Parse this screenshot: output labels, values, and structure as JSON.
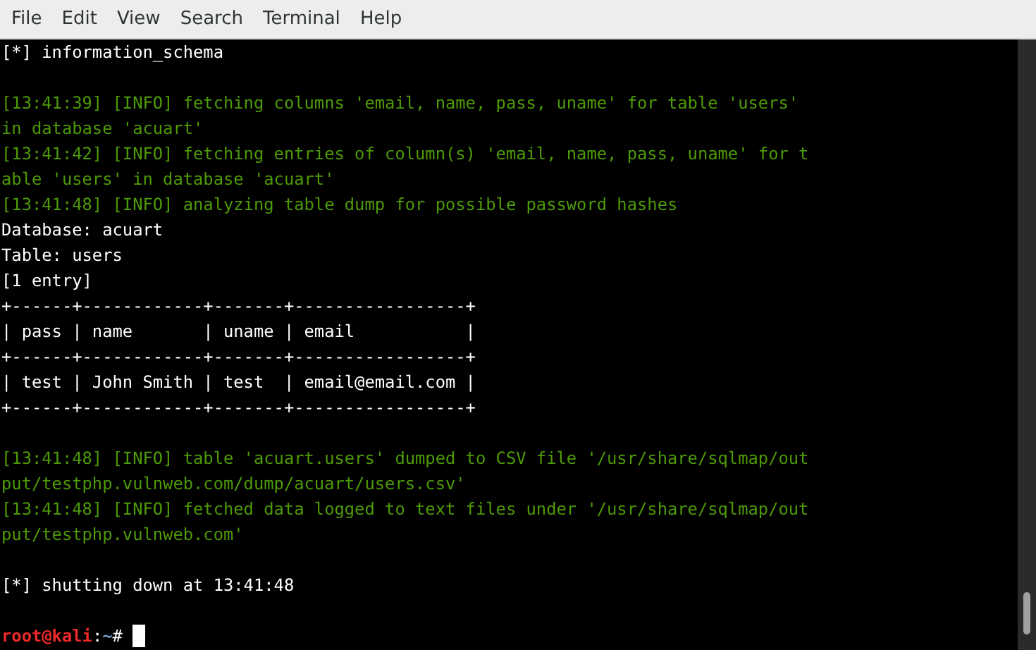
{
  "menu": [
    "File",
    "Edit",
    "View",
    "Search",
    "Terminal",
    "Help"
  ],
  "lines": [
    {
      "kind": "plain",
      "text": "[*] information_schema"
    },
    {
      "kind": "blank"
    },
    {
      "kind": "info",
      "text": "[13:41:39] [INFO] fetching columns 'email, name, pass, uname' for table 'users'"
    },
    {
      "kind": "info",
      "text": "in database 'acuart'"
    },
    {
      "kind": "info",
      "text": "[13:41:42] [INFO] fetching entries of column(s) 'email, name, pass, uname' for t"
    },
    {
      "kind": "info",
      "text": "able 'users' in database 'acuart'"
    },
    {
      "kind": "info",
      "text": "[13:41:48] [INFO] analyzing table dump for possible password hashes"
    },
    {
      "kind": "plain",
      "text": "Database: acuart"
    },
    {
      "kind": "plain",
      "text": "Table: users"
    },
    {
      "kind": "plain",
      "text": "[1 entry]"
    },
    {
      "kind": "plain",
      "text": "+------+------------+-------+-----------------+"
    },
    {
      "kind": "plain",
      "text": "| pass | name       | uname | email           |"
    },
    {
      "kind": "plain",
      "text": "+------+------------+-------+-----------------+"
    },
    {
      "kind": "plain",
      "text": "| test | John Smith | test  | email@email.com |"
    },
    {
      "kind": "plain",
      "text": "+------+------------+-------+-----------------+"
    },
    {
      "kind": "blank"
    },
    {
      "kind": "info",
      "text": "[13:41:48] [INFO] table 'acuart.users' dumped to CSV file '/usr/share/sqlmap/out"
    },
    {
      "kind": "info",
      "text": "put/testphp.vulnweb.com/dump/acuart/users.csv'"
    },
    {
      "kind": "info",
      "text": "[13:41:48] [INFO] fetched data logged to text files under '/usr/share/sqlmap/out"
    },
    {
      "kind": "info",
      "text": "put/testphp.vulnweb.com'"
    },
    {
      "kind": "blank"
    },
    {
      "kind": "plain",
      "text": "[*] shutting down at 13:41:48"
    },
    {
      "kind": "blank"
    }
  ],
  "prompt": {
    "user_host": "root@kali",
    "separator": ":",
    "path": "~",
    "symbol": "#"
  }
}
